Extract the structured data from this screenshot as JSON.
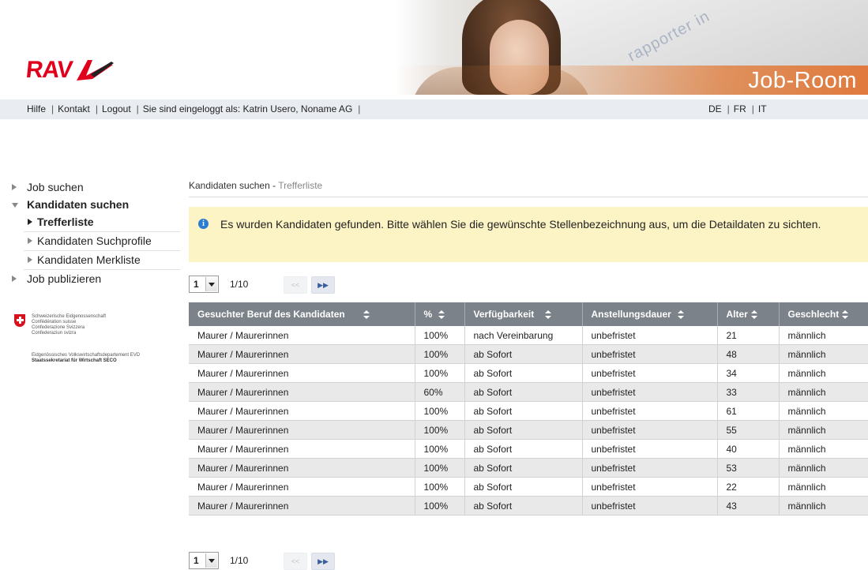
{
  "header": {
    "logo_text": "RAV",
    "banner_title": "Job-Room",
    "banner_paper_text": "rapporter in"
  },
  "topnav": {
    "left": [
      "Hilfe",
      "Kontakt",
      "Logout",
      "Sie sind eingeloggt als: Katrin Usero, Noname AG"
    ],
    "languages": [
      "DE",
      "FR",
      "IT"
    ]
  },
  "sidebar": {
    "items": [
      {
        "label": "Job suchen"
      },
      {
        "label": "Kandidaten suchen"
      },
      {
        "label": "Trefferliste"
      },
      {
        "label": "Kandidaten Suchprofile"
      },
      {
        "label": "Kandidaten Merkliste"
      },
      {
        "label": "Job publizieren"
      }
    ],
    "admin": {
      "lines": [
        "Schweizerische Eidgenossenschaft",
        "Confédération suisse",
        "Confederazione Svizzera",
        "Confederaziun svizra"
      ],
      "dept": "Eidgenössisches Volkswirtschaftsdepartement EVD",
      "secretariat": "Staatssekretariat für Wirtschaft SECO"
    }
  },
  "breadcrumb": {
    "section": "Kandidaten suchen",
    "separator": "-",
    "current": "Trefferliste"
  },
  "info": {
    "icon": "i",
    "message": "Es wurden Kandidaten gefunden. Bitte wählen Sie die gewünschte Stellenbezeichnung aus, um die Detaildaten zu sichten."
  },
  "pager": {
    "page_value": "1",
    "page_info": "1/10",
    "prev_label": "<<",
    "next_label": "▶▶"
  },
  "table": {
    "headers": [
      "Gesuchter Beruf des Kandidaten",
      "%",
      "Verfügbarkeit",
      "Anstellungsdauer",
      "Alter",
      "Geschlecht"
    ],
    "rows": [
      [
        "Maurer / Maurerinnen",
        "100%",
        "nach Vereinbarung",
        "unbefristet",
        "21",
        "männlich"
      ],
      [
        "Maurer / Maurerinnen",
        "100%",
        "ab Sofort",
        "unbefristet",
        "48",
        "männlich"
      ],
      [
        "Maurer / Maurerinnen",
        "100%",
        "ab Sofort",
        "unbefristet",
        "34",
        "männlich"
      ],
      [
        "Maurer / Maurerinnen",
        "60%",
        "ab Sofort",
        "unbefristet",
        "33",
        "männlich"
      ],
      [
        "Maurer / Maurerinnen",
        "100%",
        "ab Sofort",
        "unbefristet",
        "61",
        "männlich"
      ],
      [
        "Maurer / Maurerinnen",
        "100%",
        "ab Sofort",
        "unbefristet",
        "55",
        "männlich"
      ],
      [
        "Maurer / Maurerinnen",
        "100%",
        "ab Sofort",
        "unbefristet",
        "40",
        "männlich"
      ],
      [
        "Maurer / Maurerinnen",
        "100%",
        "ab Sofort",
        "unbefristet",
        "53",
        "männlich"
      ],
      [
        "Maurer / Maurerinnen",
        "100%",
        "ab Sofort",
        "unbefristet",
        "22",
        "männlich"
      ],
      [
        "Maurer / Maurerinnen",
        "100%",
        "ab Sofort",
        "unbefristet",
        "43",
        "männlich"
      ]
    ]
  },
  "colors": {
    "brand_red": "#e0001b",
    "info_bg": "#fdf4c5",
    "header_bg": "#7b8289",
    "row_alt": "#e9e9e9"
  }
}
